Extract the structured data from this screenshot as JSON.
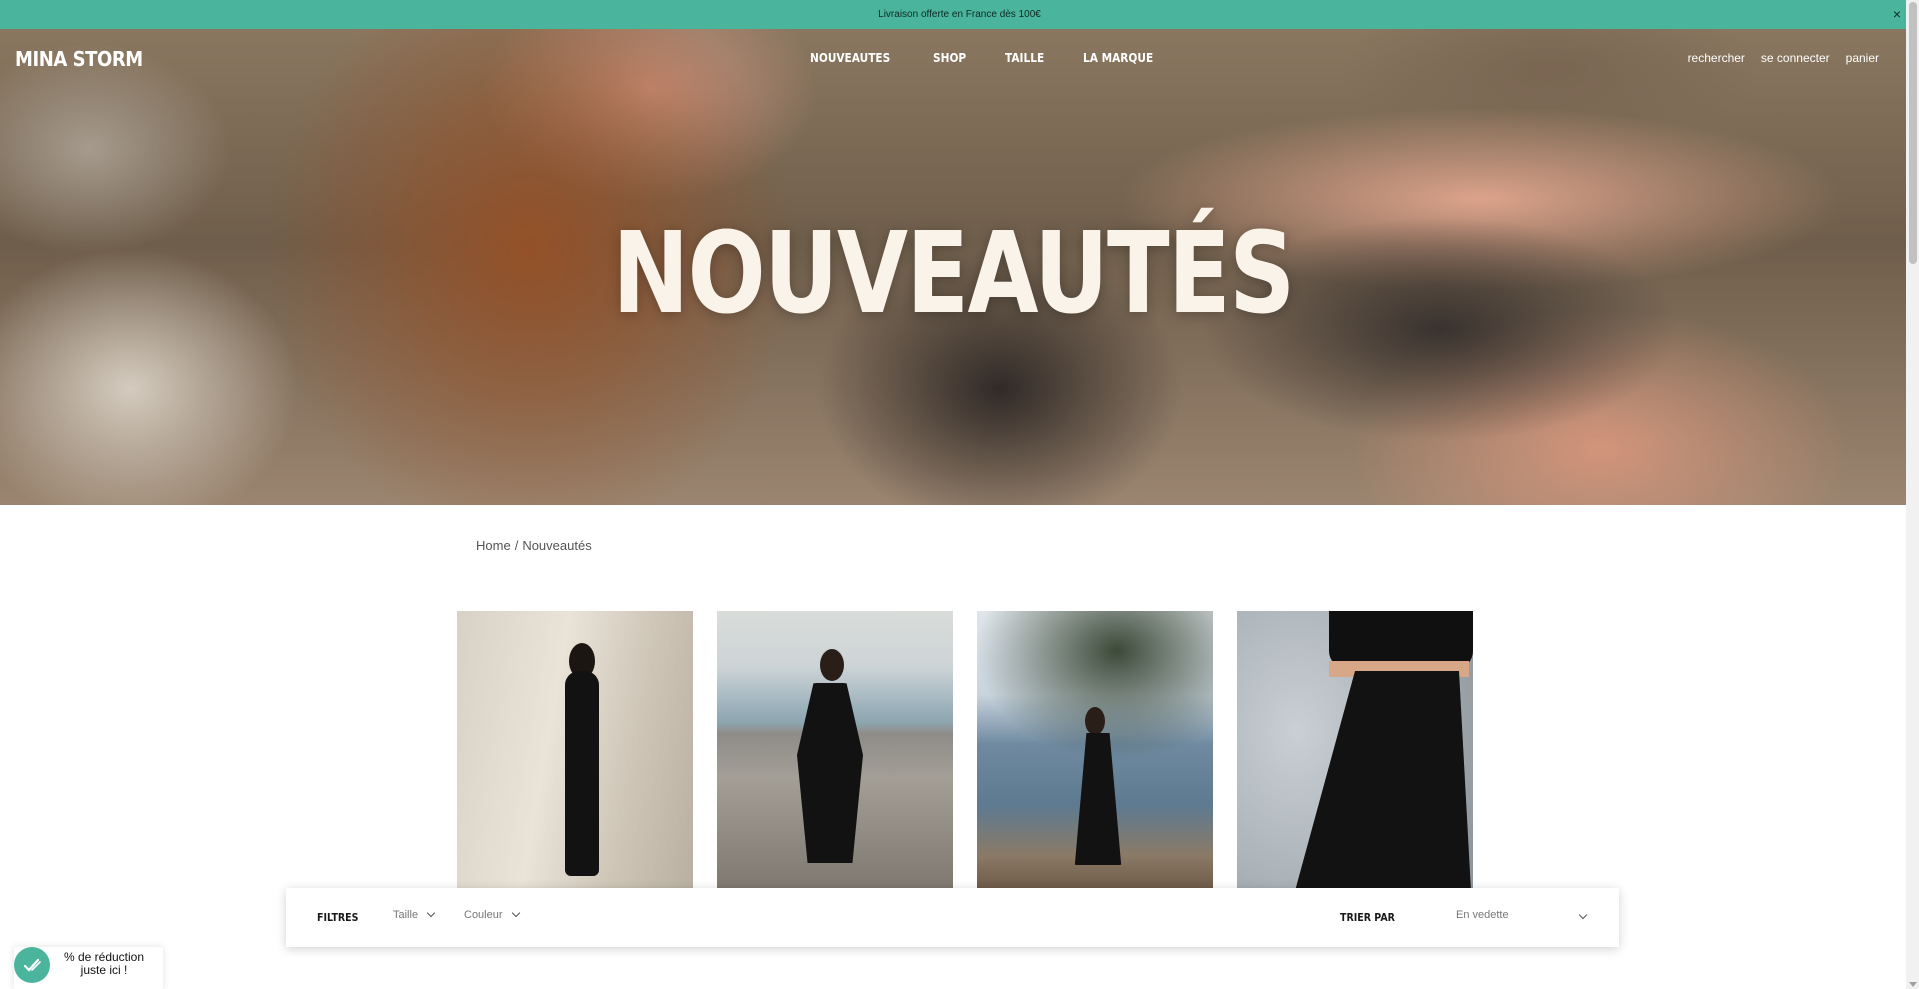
{
  "announcement": {
    "text": "Livraison offerte en France dès 100€",
    "close_label": "×"
  },
  "header": {
    "logo": "MINA STORM",
    "nav": [
      "NOUVEAUTES",
      "SHOP",
      "TAILLE",
      "LA MARQUE"
    ],
    "user_nav": {
      "search": "rechercher",
      "login": "se connecter",
      "cart": "panier"
    }
  },
  "hero": {
    "title": "NOUVEAUTÉS"
  },
  "breadcrumb": {
    "home": "Home",
    "separator": "/",
    "current": "Nouveautés"
  },
  "products": [
    {
      "image": "black-backless-long-dress-on-rocks"
    },
    {
      "image": "black-vneck-midi-dress-on-beach"
    },
    {
      "image": "black-halter-dress-by-tree"
    },
    {
      "image": "black-skirt-closeup"
    }
  ],
  "filterbar": {
    "filters_label": "FILTRES",
    "size_label": "Taille",
    "color_label": "Couleur",
    "sort_label": "TRIER PAR",
    "sort_value": "En vedette"
  },
  "discount_widget": {
    "line1": "% de réduction",
    "line2": "juste ici !"
  },
  "colors": {
    "accent": "#4bb49d",
    "hero_title": "#faf3ea"
  }
}
